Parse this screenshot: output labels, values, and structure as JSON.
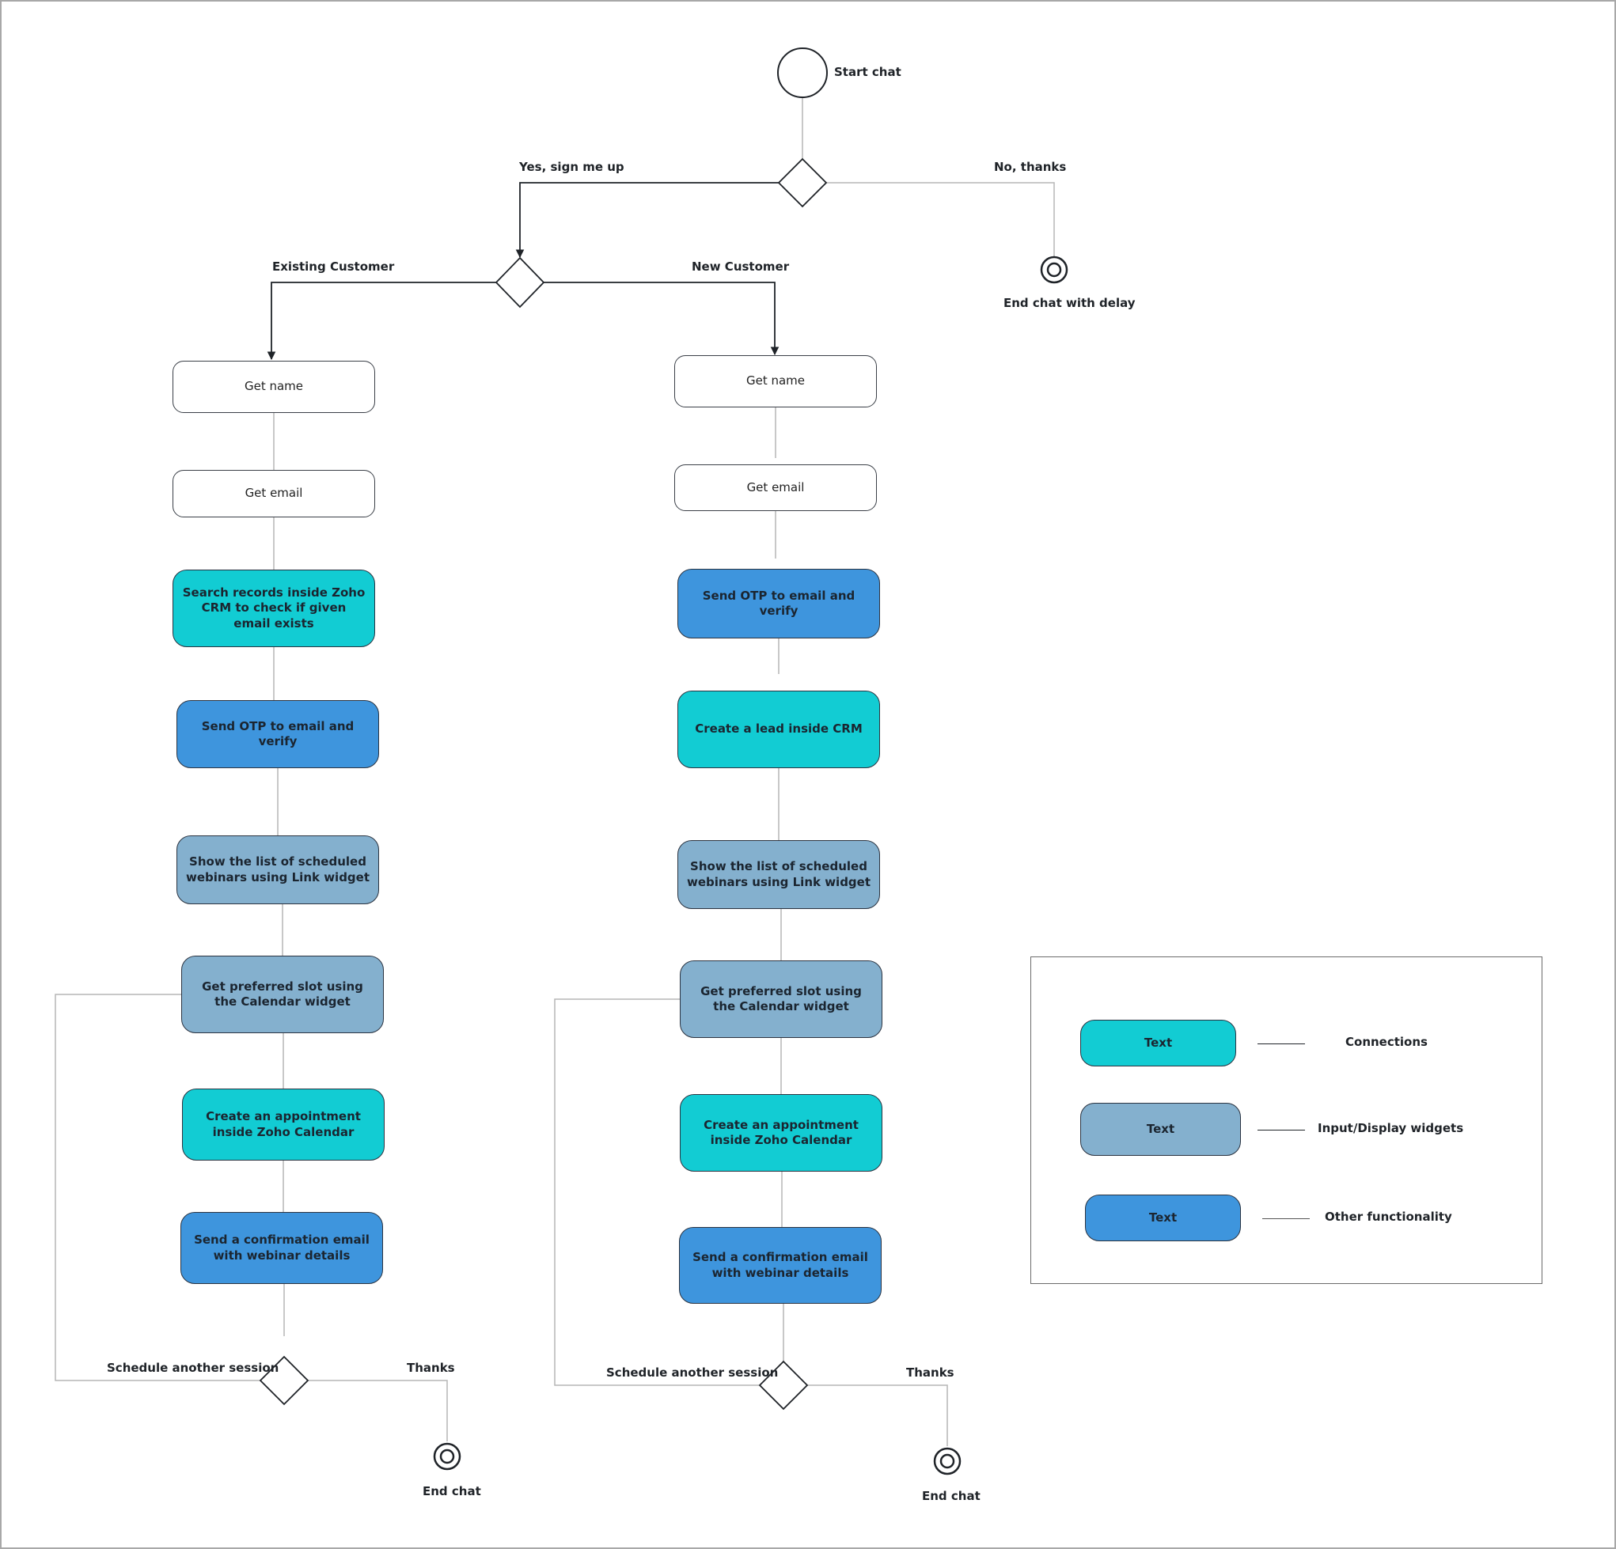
{
  "diagram": {
    "start": {
      "label": "Start chat"
    },
    "decision_signup": {
      "yes_label": "Yes, sign me up",
      "no_label": "No, thanks"
    },
    "end_delay": {
      "label": "End chat with delay"
    },
    "decision_customer": {
      "existing_label": "Existing Customer",
      "new_label": "New Customer"
    },
    "existing_flow": {
      "steps": [
        {
          "text": "Get name",
          "category": "plain"
        },
        {
          "text": "Get email",
          "category": "plain"
        },
        {
          "text": "Search records inside Zoho CRM to check if given email exists",
          "category": "connections"
        },
        {
          "text": "Send OTP to email and verify",
          "category": "other"
        },
        {
          "text": "Show the list of scheduled webinars using Link widget",
          "category": "widgets"
        },
        {
          "text": "Get preferred slot using the Calendar widget",
          "category": "widgets"
        },
        {
          "text": "Create an appointment inside Zoho Calendar",
          "category": "connections"
        },
        {
          "text": "Send a confirmation email with webinar details",
          "category": "other"
        }
      ],
      "decision": {
        "loop_label": "Schedule another session",
        "exit_label": "Thanks"
      },
      "end": {
        "label": "End chat"
      }
    },
    "new_flow": {
      "steps": [
        {
          "text": "Get name",
          "category": "plain"
        },
        {
          "text": "Get email",
          "category": "plain"
        },
        {
          "text": "Send OTP to email and verify",
          "category": "other"
        },
        {
          "text": "Create a lead inside CRM",
          "category": "connections"
        },
        {
          "text": "Show the list of scheduled webinars using Link widget",
          "category": "widgets"
        },
        {
          "text": "Get preferred slot using the Calendar widget",
          "category": "widgets"
        },
        {
          "text": "Create an appointment inside Zoho Calendar",
          "category": "connections"
        },
        {
          "text": "Send a confirmation email with webinar details",
          "category": "other"
        }
      ],
      "decision": {
        "loop_label": "Schedule another session",
        "exit_label": "Thanks"
      },
      "end": {
        "label": "End chat"
      }
    }
  },
  "legend": {
    "items": [
      {
        "swatch_text": "Text",
        "label": "Connections",
        "color": "#12ccd3"
      },
      {
        "swatch_text": "Text",
        "label": "Input/Display widgets",
        "color": "#84b0ce"
      },
      {
        "swatch_text": "Text",
        "label": "Other functionality",
        "color": "#3e95dd"
      }
    ]
  },
  "colors": {
    "connections": "#12ccd3",
    "widgets": "#84b0ce",
    "other": "#3e95dd",
    "plain": "#ffffff",
    "connector_dark": "#1f2328",
    "connector_light": "#b5b5b5"
  }
}
